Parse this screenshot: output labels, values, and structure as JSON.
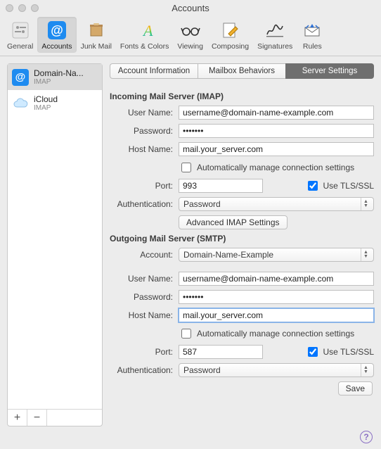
{
  "window": {
    "title": "Accounts"
  },
  "toolbar": {
    "items": [
      {
        "label": "General"
      },
      {
        "label": "Accounts"
      },
      {
        "label": "Junk Mail"
      },
      {
        "label": "Fonts & Colors"
      },
      {
        "label": "Viewing"
      },
      {
        "label": "Composing"
      },
      {
        "label": "Signatures"
      },
      {
        "label": "Rules"
      }
    ]
  },
  "sidebar": {
    "accounts": [
      {
        "name": "Domain-Na...",
        "type": "IMAP"
      },
      {
        "name": "iCloud",
        "type": "IMAP"
      }
    ],
    "add_glyph": "+",
    "remove_glyph": "−"
  },
  "tabs": [
    "Account Information",
    "Mailbox Behaviors",
    "Server Settings"
  ],
  "incoming": {
    "section": "Incoming Mail Server (IMAP)",
    "labels": {
      "username": "User Name:",
      "password": "Password:",
      "hostname": "Host Name:",
      "port": "Port:",
      "auth": "Authentication:"
    },
    "username": "username@domain-name-example.com",
    "password": "•••••••",
    "hostname": "mail.your_server.com",
    "auto_label": "Automatically manage connection settings",
    "auto": false,
    "port": "993",
    "tls_label": "Use TLS/SSL",
    "tls": true,
    "auth": "Password",
    "advanced_btn": "Advanced IMAP Settings"
  },
  "outgoing": {
    "section": "Outgoing Mail Server (SMTP)",
    "labels": {
      "account": "Account:",
      "username": "User Name:",
      "password": "Password:",
      "hostname": "Host Name:",
      "port": "Port:",
      "auth": "Authentication:"
    },
    "account": "Domain-Name-Example",
    "username": "username@domain-name-example.com",
    "password": "•••••••",
    "hostname": "mail.your_server.com",
    "auto_label": "Automatically manage connection settings",
    "auto": false,
    "port": "587",
    "tls_label": "Use TLS/SSL",
    "tls": true,
    "auth": "Password"
  },
  "save_label": "Save",
  "help_glyph": "?"
}
